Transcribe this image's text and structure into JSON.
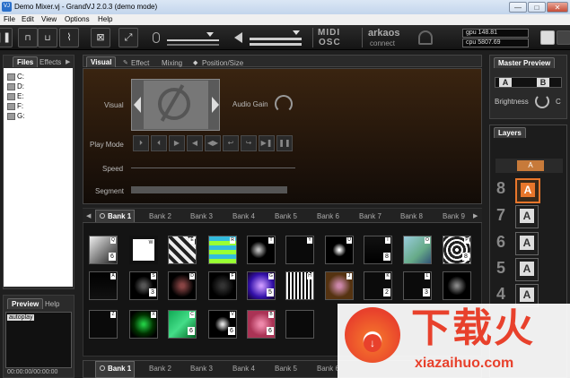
{
  "window": {
    "title": "Demo Mixer.vj - GrandVJ 2.0.3  (demo mode)",
    "min": "—",
    "max": "□",
    "close": "✕"
  },
  "menu": [
    "File",
    "Edit",
    "View",
    "Options",
    "Help"
  ],
  "toolbar": {
    "midi": "MIDI",
    "osc": "OSC",
    "arkaos": "arkaos",
    "connect": "connect",
    "gpu": "gpu 148.81",
    "cpu": "cpu 5807.69"
  },
  "left": {
    "tabs": [
      "Files",
      "Effects"
    ],
    "drives": [
      "C:",
      "D:",
      "E:",
      "F:",
      "G:"
    ],
    "preview_tabs": [
      "Preview",
      "Help"
    ],
    "autoplay": "autoplay",
    "timecode": "00:00:00/00:00:00"
  },
  "visual": {
    "tabs": [
      "Visual",
      "Effect",
      "Mixing",
      "Position/Size"
    ],
    "visual_label": "Visual",
    "audio_gain_label": "Audio Gain",
    "play_mode_label": "Play Mode",
    "speed_label": "Speed",
    "segment_label": "Segment"
  },
  "banks": {
    "tabs": [
      "Bank 1",
      "Bank 2",
      "Bank 3",
      "Bank 4",
      "Bank 5",
      "Bank 6",
      "Bank 7",
      "Bank 8",
      "Bank 9"
    ],
    "bottom_tabs": [
      "Bank 1",
      "Bank 2",
      "Bank 3",
      "Bank 4",
      "Bank 5",
      "Bank 6"
    ],
    "row1_nums": [
      "6",
      "",
      "",
      "",
      "",
      "",
      "",
      "8",
      "",
      "8"
    ],
    "row1_letters": [
      "Q",
      "W",
      "E",
      "R",
      "T",
      "Y",
      "U",
      "I",
      "O",
      "P"
    ],
    "row2_nums": [
      "",
      "3",
      "",
      "",
      "5",
      "",
      "",
      "2",
      "3",
      ""
    ],
    "row2_letters": [
      "A",
      "S",
      "D",
      "F",
      "G",
      "H",
      "J",
      "K",
      "L",
      ""
    ],
    "row3_nums": [
      "",
      "",
      "6",
      "6",
      "6",
      ""
    ],
    "row3_letters": [
      "Z",
      "X",
      "C",
      "V",
      "B",
      ""
    ]
  },
  "master": {
    "title": "Master Preview",
    "brightness": "Brightness",
    "c_label": "C"
  },
  "layers": {
    "title": "Layers",
    "letter": "A",
    "numbers": [
      "8",
      "7",
      "6",
      "5",
      "4"
    ]
  },
  "watermark": {
    "text": "下载火",
    "domain": "xiazaihuo.com"
  },
  "colors": {
    "accent_orange": "#e8762b",
    "active_layer_border": "#e8762b",
    "watermark_red": "#e8412c"
  }
}
